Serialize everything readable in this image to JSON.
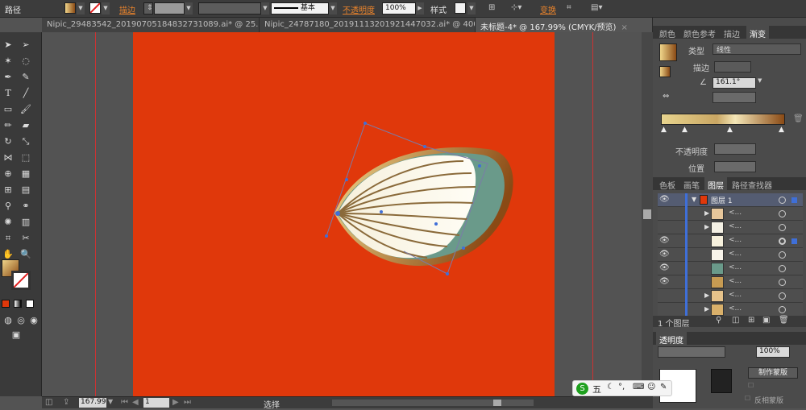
{
  "control_bar": {
    "selection_type": "路径",
    "stroke_label": "描边",
    "stroke_profile": "基本",
    "opacity_label": "不透明度",
    "opacity_value": "100%",
    "style_label": "样式",
    "transform_label": "变换"
  },
  "tabs": [
    {
      "label": "Nipic_29483542_20190705184832731089.ai* @ 25..."
    },
    {
      "label": "Nipic_24787180_20191113201921447032.ai* @ 400..."
    },
    {
      "label": "未标题-4* @ 167.99% (CMYK/预览)"
    }
  ],
  "status_bar": {
    "zoom": "167.99",
    "page": "1",
    "tool_name": "选择"
  },
  "gradient_panel": {
    "tabs": [
      "颜色",
      "颜色参考",
      "描边",
      "渐变"
    ],
    "type_label": "类型",
    "type_value": "线性",
    "stroke_label": "描边",
    "angle_value": "161.1°",
    "opacity_label": "不透明度",
    "position_label": "位置"
  },
  "layers_panel": {
    "tabs": [
      "色板",
      "画笔",
      "图层",
      "路径查找器"
    ],
    "top_layer_name": "图层 1",
    "sublayer_label": "<...",
    "layer_count": "1 个图层"
  },
  "transparency_panel": {
    "tab": "透明度",
    "opacity_value": "100%",
    "make_mask_label": "制作蒙版",
    "invert_mask_label": "反相蒙版"
  },
  "ime_bar": {
    "label": "五"
  },
  "colors": {
    "artboard": "#e0380b",
    "gradient_start": "#f0d58a",
    "gradient_end": "#8a4a15",
    "selection": "#3f6fd8"
  }
}
